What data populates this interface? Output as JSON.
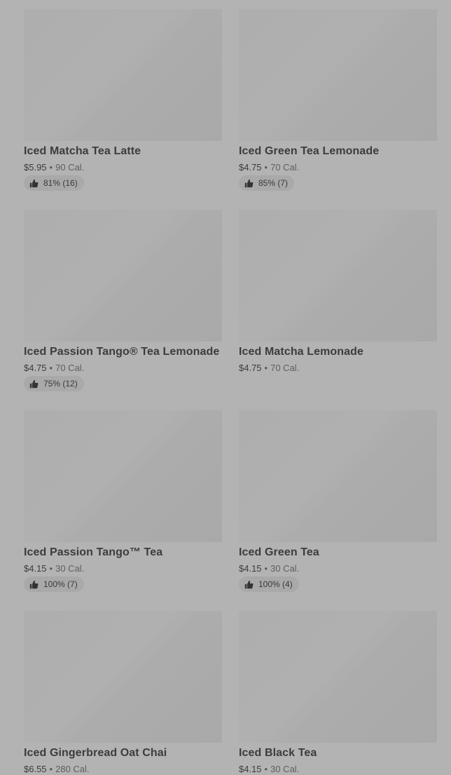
{
  "products": [
    {
      "name": "Iced Matcha Tea Latte",
      "price": "$5.95",
      "calories": "90 Cal.",
      "rating": "81% (16)"
    },
    {
      "name": "Iced Green Tea Lemonade",
      "price": "$4.75",
      "calories": "70 Cal.",
      "rating": "85% (7)"
    },
    {
      "name": "Iced Passion Tango® Tea Lemonade",
      "price": "$4.75",
      "calories": "70 Cal.",
      "rating": "75% (12)"
    },
    {
      "name": "Iced Matcha Lemonade",
      "price": "$4.75",
      "calories": "70 Cal.",
      "rating": ""
    },
    {
      "name": "Iced Passion Tango™ Tea",
      "price": "$4.15",
      "calories": "30 Cal.",
      "rating": "100% (7)"
    },
    {
      "name": "Iced Green Tea",
      "price": "$4.15",
      "calories": "30 Cal.",
      "rating": "100% (4)"
    },
    {
      "name": "Iced Gingerbread Oat Chai",
      "price": "$6.55",
      "calories": "280 Cal.",
      "rating": ""
    },
    {
      "name": "Iced Black Tea",
      "price": "$4.15",
      "calories": "30 Cal.",
      "rating": ""
    }
  ],
  "separator": "•",
  "icons": {
    "rating": "thumbs-up-icon"
  }
}
